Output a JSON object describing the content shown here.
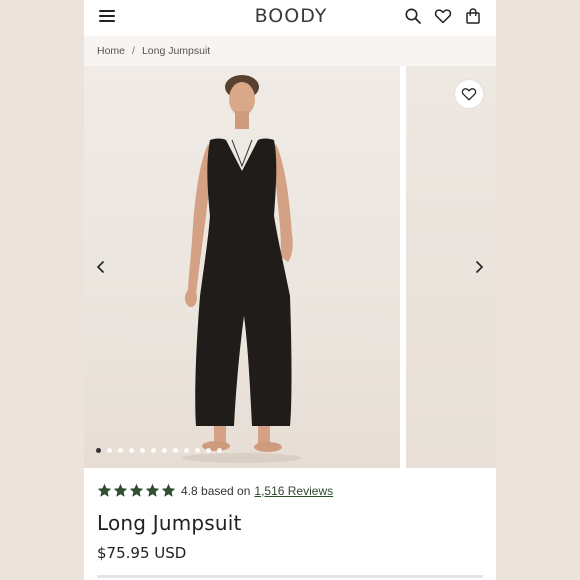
{
  "header": {
    "logo": "BOODY",
    "icons": [
      "menu-icon",
      "search-icon",
      "heart-icon",
      "bag-icon"
    ]
  },
  "breadcrumb": {
    "home": "Home",
    "separator": "/",
    "current": "Long Jumpsuit"
  },
  "gallery": {
    "slide_count": 12,
    "active_slide": 1,
    "icons": [
      "chevron-left-icon",
      "chevron-right-icon",
      "wishlist-heart-icon"
    ]
  },
  "rating": {
    "stars": 5,
    "score_text": "4.8 based on",
    "reviews_link": "1,516 Reviews",
    "star_color": "#2f4f2f"
  },
  "product": {
    "title": "Long Jumpsuit",
    "price": "$75.95 USD"
  }
}
